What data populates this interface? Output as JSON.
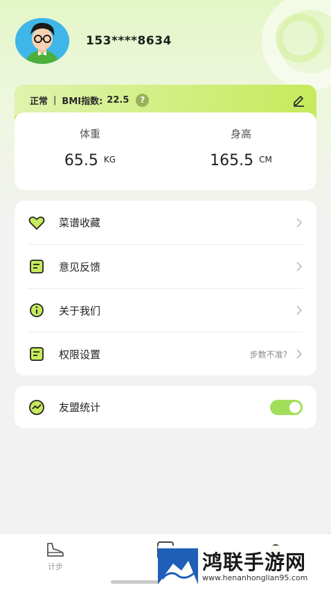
{
  "profile": {
    "phone": "153****8634"
  },
  "bmi": {
    "status": "正常",
    "separator": "|",
    "bmi_label": "BMI指数:",
    "bmi_value": "22.5",
    "help_icon": "question-icon",
    "edit_icon": "pencil-icon"
  },
  "metrics": {
    "weight": {
      "label": "体重",
      "value": "65.5",
      "unit": "KG"
    },
    "height": {
      "label": "身高",
      "value": "165.5",
      "unit": "CM"
    }
  },
  "menu": {
    "items": [
      {
        "label": "菜谱收藏",
        "icon": "heart-icon",
        "hint": ""
      },
      {
        "label": "意见反馈",
        "icon": "feedback-icon",
        "hint": ""
      },
      {
        "label": "关于我们",
        "icon": "info-icon",
        "hint": ""
      },
      {
        "label": "权限设置",
        "icon": "settings-doc-icon",
        "hint": "步数不准?"
      }
    ]
  },
  "stats": {
    "label": "友盟统计",
    "icon": "chart-icon",
    "enabled": true
  },
  "tabbar": {
    "tabs": [
      {
        "label": "计步",
        "icon": "shoe-icon"
      },
      {
        "label": "",
        "icon": "document-icon"
      },
      {
        "label": "",
        "icon": "profile-icon"
      }
    ]
  },
  "watermark": {
    "title": "鸿联手游网",
    "url": "www.henanhonglian95.com"
  },
  "colors": {
    "accent": "#c6ea5c",
    "toggle": "#a3de5a",
    "background": "#f2f2f2"
  }
}
